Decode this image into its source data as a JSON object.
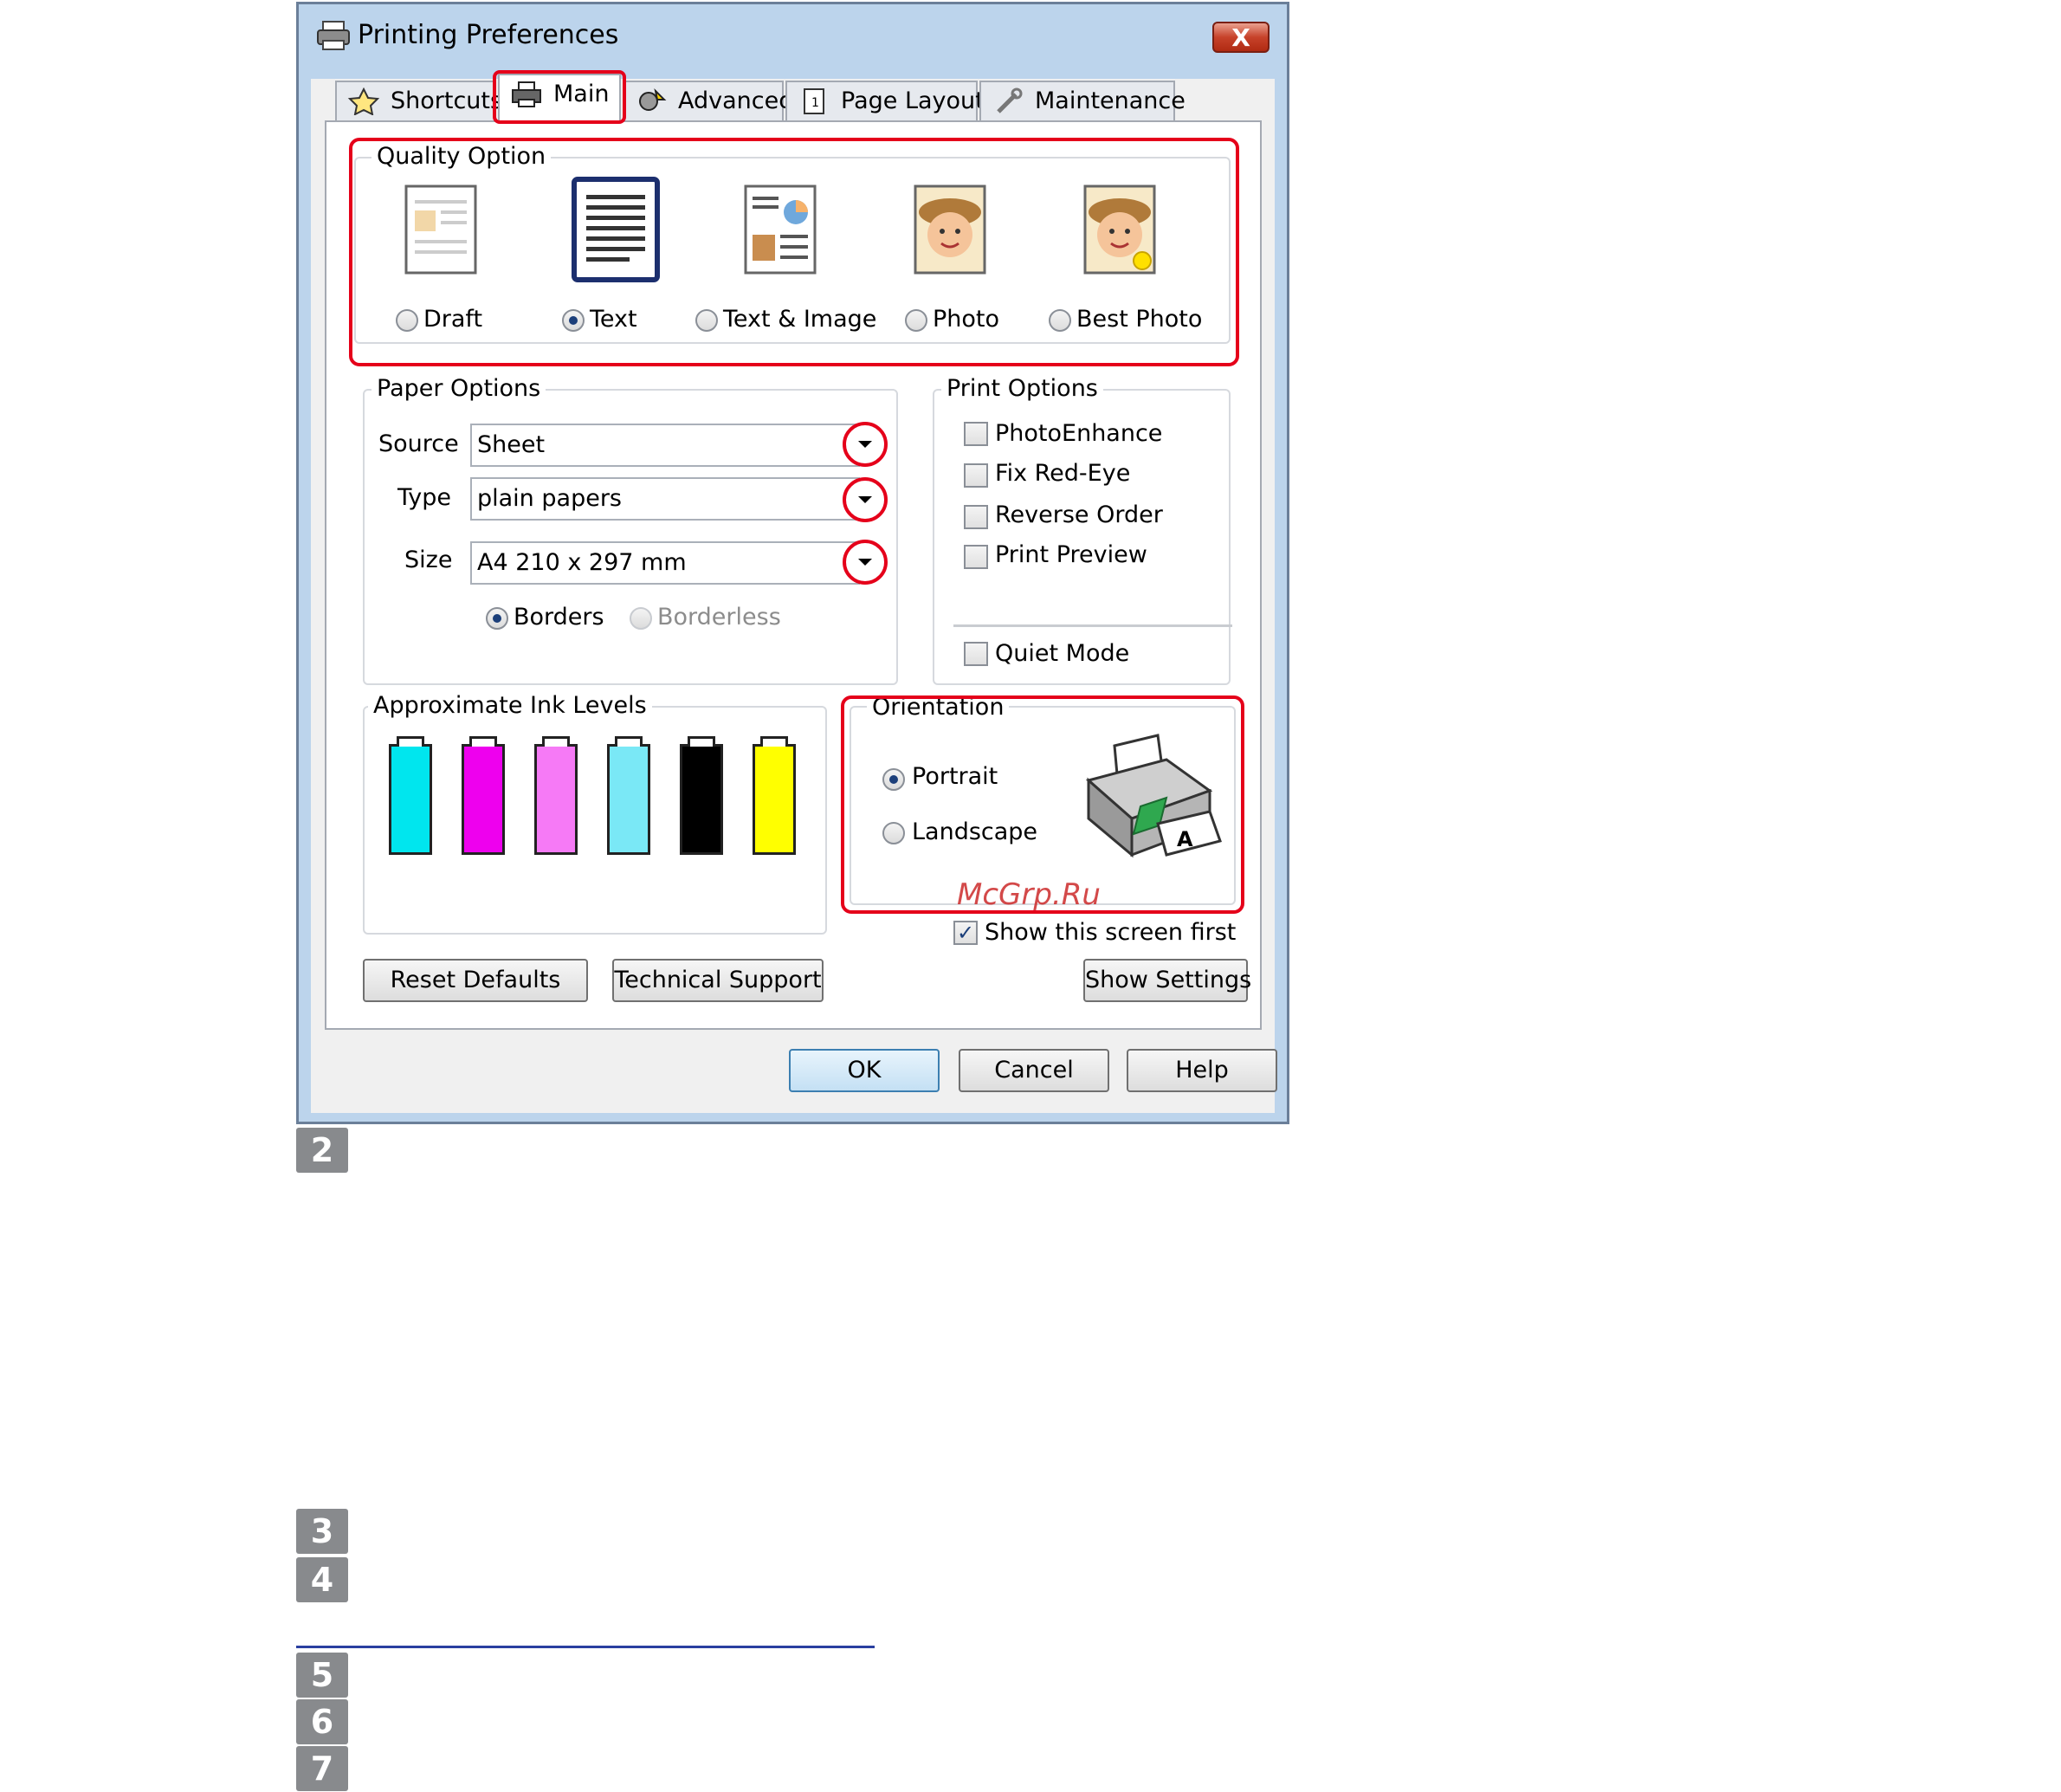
{
  "dialog": {
    "title": "Printing Preferences",
    "close_label": "X",
    "tabs": [
      {
        "label": "Shortcuts",
        "icon": "star-icon"
      },
      {
        "label": "Main",
        "icon": "printer-icon"
      },
      {
        "label": "Advanced",
        "icon": "advanced-icon"
      },
      {
        "label": "Page Layout",
        "icon": "page-layout-icon"
      },
      {
        "label": "Maintenance",
        "icon": "wrench-icon"
      }
    ],
    "quality": {
      "title": "Quality Option",
      "options": [
        "Draft",
        "Text",
        "Text & Image",
        "Photo",
        "Best Photo"
      ],
      "selected": "Text"
    },
    "paper": {
      "title": "Paper Options",
      "source_label": "Source",
      "source_value": "Sheet",
      "type_label": "Type",
      "type_value": "plain papers",
      "size_label": "Size",
      "size_value": "A4 210 x 297 mm",
      "borders_label": "Borders",
      "borderless_label": "Borderless"
    },
    "print_options": {
      "title": "Print Options",
      "items": [
        "PhotoEnhance",
        "Fix Red-Eye",
        "Reverse Order",
        "Print Preview"
      ],
      "quiet_mode": "Quiet Mode"
    },
    "ink": {
      "title": "Approximate Ink Levels",
      "colors": [
        "#00e6ee",
        "#ee00ee",
        "#f67af6",
        "#7ae8f6",
        "#000000",
        "#ffff00"
      ]
    },
    "orientation": {
      "title": "Orientation",
      "portrait": "Portrait",
      "landscape": "Landscape"
    },
    "watermark": "McGrp.Ru",
    "show_first": "Show this screen first",
    "buttons": {
      "reset": "Reset Defaults",
      "support": "Technical Support",
      "settings": "Show Settings",
      "ok": "OK",
      "cancel": "Cancel",
      "help": "Help"
    }
  },
  "steps": [
    "2",
    "3",
    "4",
    "5",
    "6",
    "7"
  ]
}
